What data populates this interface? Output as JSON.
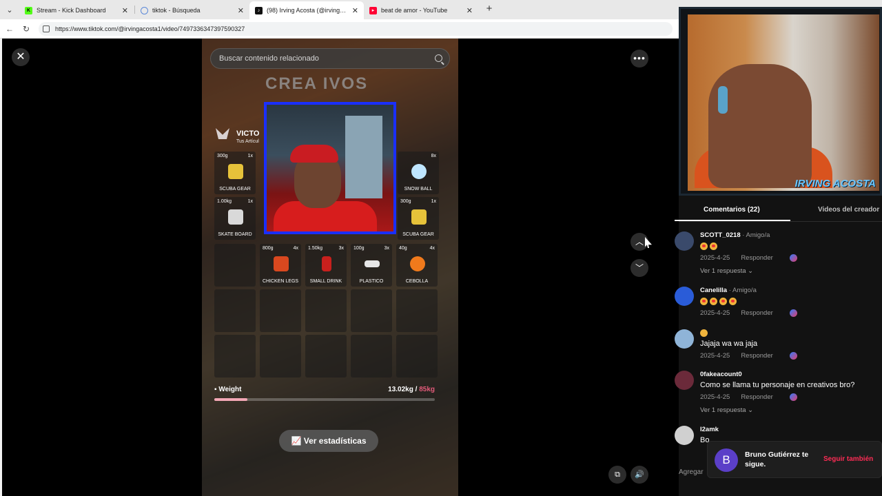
{
  "browser": {
    "tabs": [
      {
        "title": "Stream - Kick Dashboard",
        "favicon_color": "#53fc18"
      },
      {
        "title": "tiktok - Búsqueda",
        "favicon_color": "#5b88d8"
      },
      {
        "title": "(98) Irving Acosta (@irvingaco",
        "favicon_color": "#111111"
      },
      {
        "title": "beat de amor - YouTube",
        "favicon_color": "#ff0033"
      }
    ],
    "url": "https://www.tiktok.com/@irvingacosta1/video/7497336347397590327"
  },
  "video": {
    "search_placeholder": "Buscar contenido relacionado",
    "brand_text": "CREA  IVOS",
    "inventory_title": "VICTO",
    "inventory_sub": "Tus Artícul",
    "slots": [
      {
        "weight": "300g",
        "qty": "1x",
        "name": "SCUBA GEAR",
        "color": "#e6c23a"
      },
      {
        "weight": "",
        "qty": "8x",
        "name": "SNOW BALL",
        "color": "#bfe6ff"
      },
      {
        "weight": "1.00kg",
        "qty": "1x",
        "name": "SKATE BOARD",
        "color": "#d9d9d9"
      },
      {
        "weight": "300g",
        "qty": "1x",
        "name": "SCUBA GEAR",
        "color": "#e6c23a"
      },
      {
        "weight": "800g",
        "qty": "4x",
        "name": "CHICKEN LEGS",
        "color": "#d9481f"
      },
      {
        "weight": "1.50kg",
        "qty": "3x",
        "name": "SMALL DRINK",
        "color": "#c8201d"
      },
      {
        "weight": "100g",
        "qty": "3x",
        "name": "PLASTICO",
        "color": "#e6e6e6"
      },
      {
        "weight": "40g",
        "qty": "4x",
        "name": "CEBOLLA",
        "color": "#f07a1c"
      }
    ],
    "weight_label": "Weight",
    "weight_current": "13.02kg",
    "weight_max": "85kg",
    "weight_fraction": 0.15,
    "stats_button": "Ver estadísticas"
  },
  "overlay": {
    "streamer_name": "IRVING ACOSTA"
  },
  "side": {
    "tab_comments": "Comentarios (22)",
    "tab_creator_videos": "Videos del creador",
    "comments": [
      {
        "user": "SCOTT_0218",
        "friend": " · Amigo/a",
        "text": "",
        "emojis": 2,
        "date": "2025-4-25",
        "reply": "Responder",
        "replies": "Ver 1 respuesta ⌄",
        "avatar_color": "#3a4a6b"
      },
      {
        "user": "Canelilla",
        "friend": " · Amigo/a",
        "text": "",
        "emojis": 4,
        "date": "2025-4-25",
        "reply": "Responder",
        "replies": "",
        "avatar_color": "#2a5cd8"
      },
      {
        "user": "",
        "friend": "",
        "text": "Jajaja wa wa jaja",
        "emojis": 1,
        "date": "2025-4-25",
        "reply": "Responder",
        "replies": "",
        "avatar_color": "#8fb4d8"
      },
      {
        "user": "0fakeacount0",
        "friend": "",
        "text": "Como se llama tu personaje en creativos bro?",
        "emojis": 0,
        "date": "2025-4-25",
        "reply": "Responder",
        "replies": "Ver 1 respuesta ⌄",
        "avatar_color": "#6b2a3a"
      },
      {
        "user": "I2amk",
        "friend": "",
        "text": "Bo",
        "emojis": 0,
        "date": "",
        "reply": "",
        "replies": "",
        "avatar_color": "#d0d0d0"
      }
    ],
    "add_comment": "Agregar"
  },
  "toast": {
    "initial": "B",
    "text": "Bruno Gutiérrez te sigue.",
    "follow": "Seguir también"
  }
}
